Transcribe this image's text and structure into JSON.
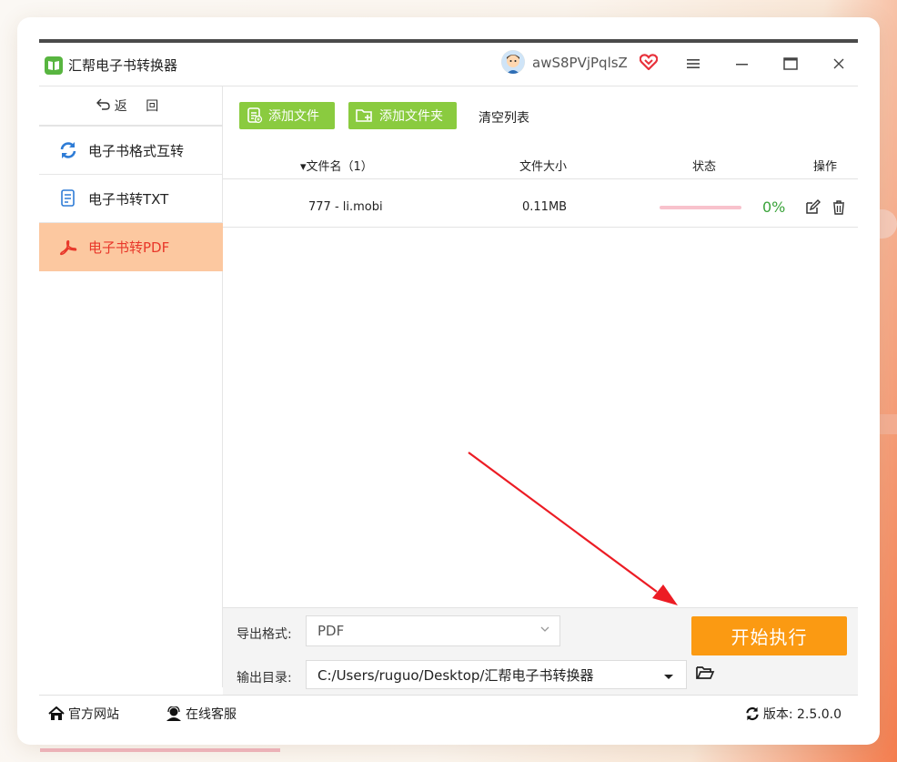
{
  "app": {
    "title": "汇帮电子书转换器",
    "username": "awS8PVjPqlsZ"
  },
  "sidebar": {
    "back_label": "返 回",
    "items": [
      {
        "label": "电子书格式互转",
        "icon": "refresh-icon",
        "active": false
      },
      {
        "label": "电子书转TXT",
        "icon": "document-icon",
        "active": false
      },
      {
        "label": "电子书转PDF",
        "icon": "pdf-icon",
        "active": true
      }
    ]
  },
  "toolbar": {
    "add_file": "添加文件",
    "add_folder": "添加文件夹",
    "clear_list": "清空列表"
  },
  "table": {
    "headers": {
      "filename": "▾文件名（1）",
      "filesize": "文件大小",
      "status": "状态",
      "actions": "操作"
    },
    "rows": [
      {
        "filename": "777 - li.mobi",
        "filesize": "0.11MB",
        "progress": 0,
        "percent": "0%"
      }
    ]
  },
  "settings": {
    "format_label": "导出格式:",
    "format_value": "PDF",
    "output_label": "输出目录:",
    "output_value": "C:/Users/ruguo/Desktop/汇帮电子书转换器",
    "start_label": "开始执行"
  },
  "footer": {
    "website": "官方网站",
    "support": "在线客服",
    "version": "版本:  2.5.0.0"
  },
  "colors": {
    "accent_green": "#8acb3f",
    "active_bg": "#fcc8a0",
    "active_text": "#e8382a",
    "start_button": "#fb9a12",
    "percent_green": "#3aa33a"
  }
}
